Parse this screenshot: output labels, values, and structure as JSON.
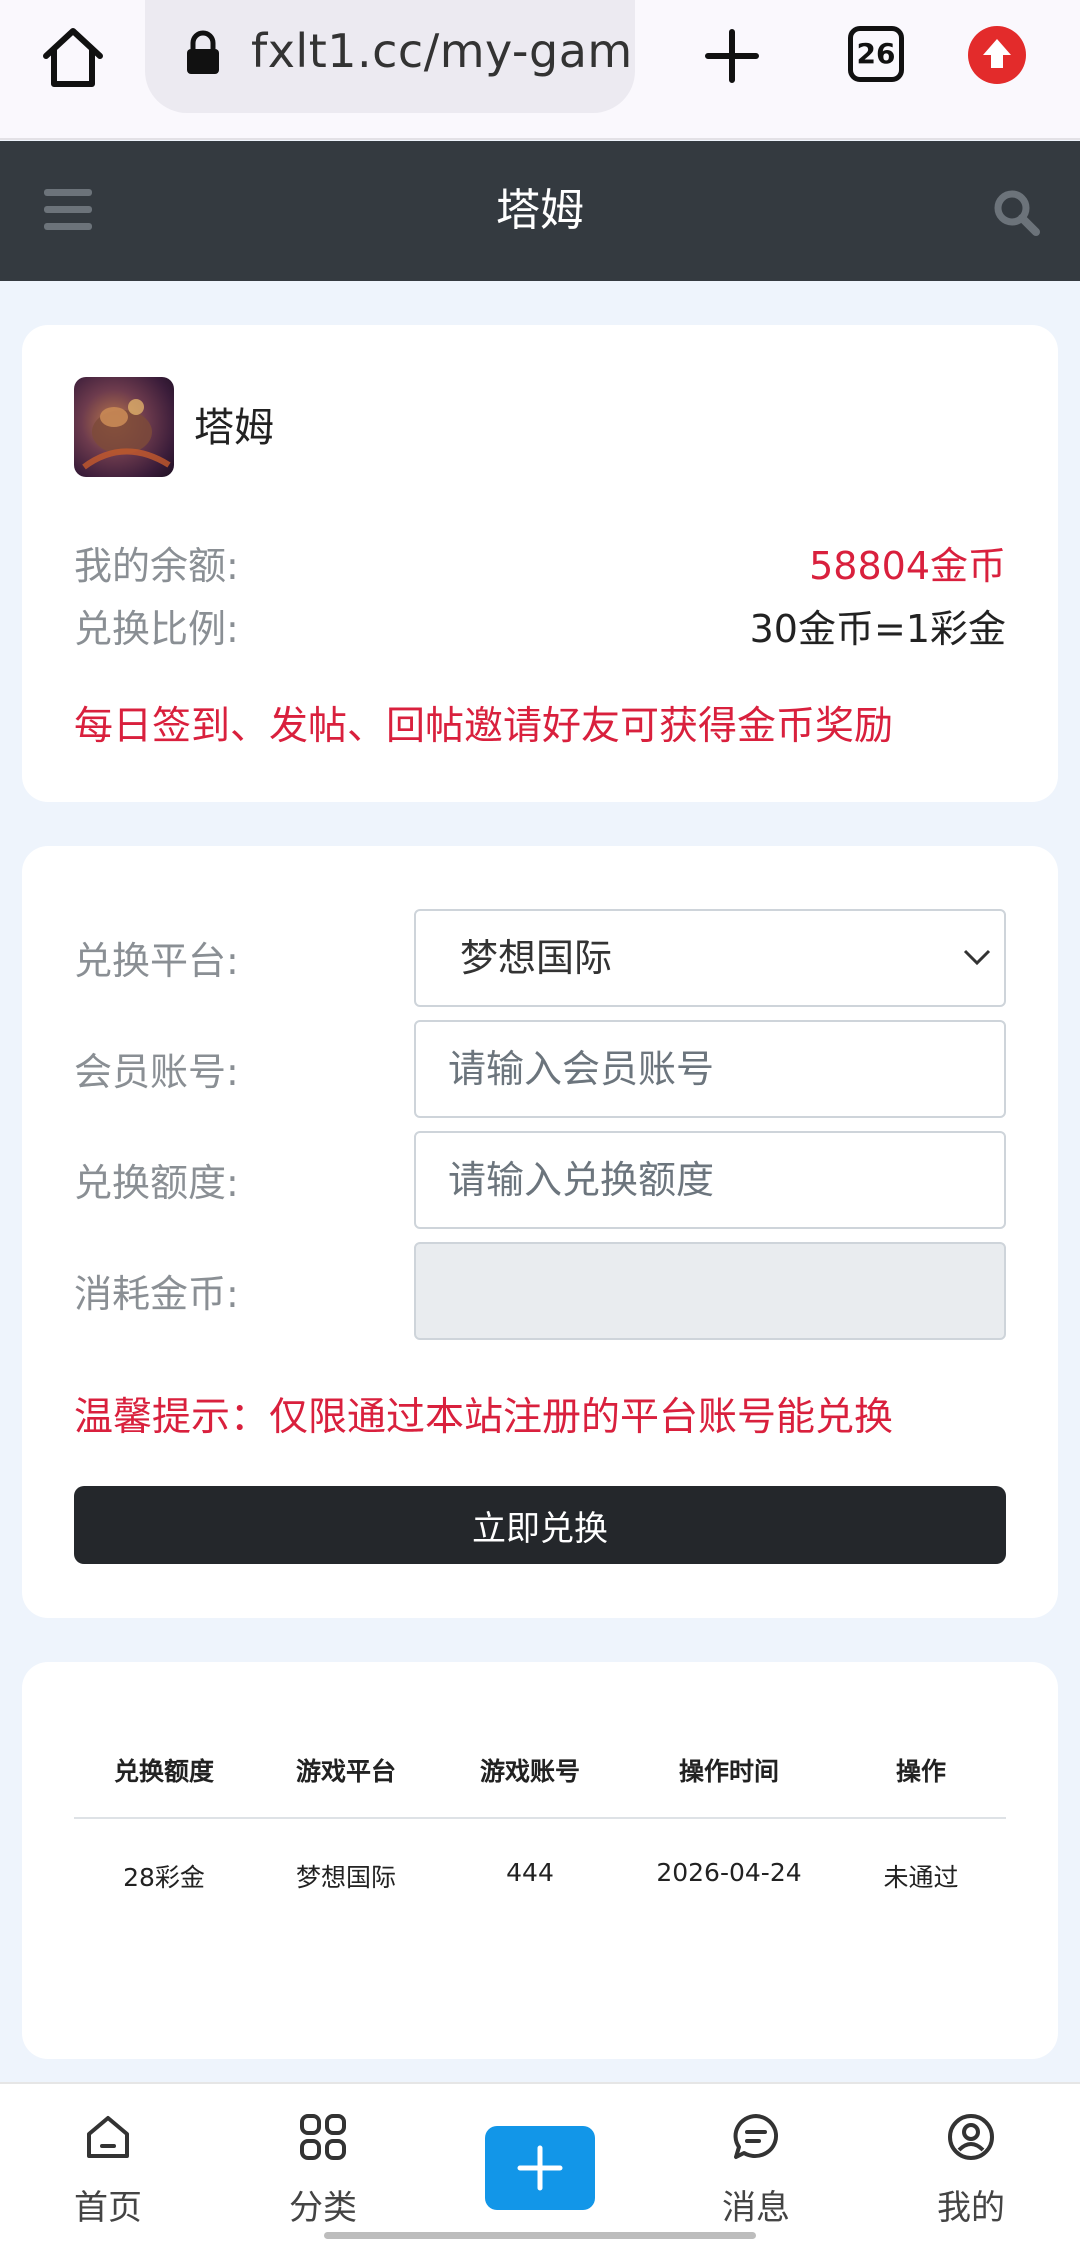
{
  "browser": {
    "url": "fxlt1.cc/my-gam",
    "tab_count": "26"
  },
  "header": {
    "title": "塔姆"
  },
  "profile": {
    "game_name": "塔姆",
    "balance_label": "我的余额:",
    "balance_value": "58804金币",
    "ratio_label": "兑换比例:",
    "ratio_value": "30金币=1彩金",
    "promo_text": "每日签到、发帖、回帖邀请好友可获得金币奖励"
  },
  "form": {
    "platform_label": "兑换平台:",
    "platform_value": "梦想国际",
    "account_label": "会员账号:",
    "account_placeholder": "请输入会员账号",
    "amount_label": "兑换额度:",
    "amount_placeholder": "请输入兑换额度",
    "cost_label": "消耗金币:",
    "cost_value": "",
    "tip": "温馨提示：仅限通过本站注册的平台账号能兑换",
    "submit_label": "立即兑换"
  },
  "records": {
    "headers": [
      "兑换额度",
      "游戏平台",
      "游戏账号",
      "操作时间",
      "操作"
    ],
    "rows": [
      [
        "28彩金",
        "梦想国际",
        "444",
        "2026-04-24",
        "未通过"
      ]
    ]
  },
  "bottom_nav": {
    "items": [
      {
        "label": "首页",
        "icon": "home-icon"
      },
      {
        "label": "分类",
        "icon": "grid-icon"
      },
      {
        "label": "",
        "icon": "plus-icon"
      },
      {
        "label": "消息",
        "icon": "message-icon"
      },
      {
        "label": "我的",
        "icon": "user-icon"
      }
    ]
  },
  "colors": {
    "accent_red": "#d9203d",
    "header_bg": "#343a40",
    "button_dark": "#24272b",
    "plus_blue": "#1296e8"
  }
}
